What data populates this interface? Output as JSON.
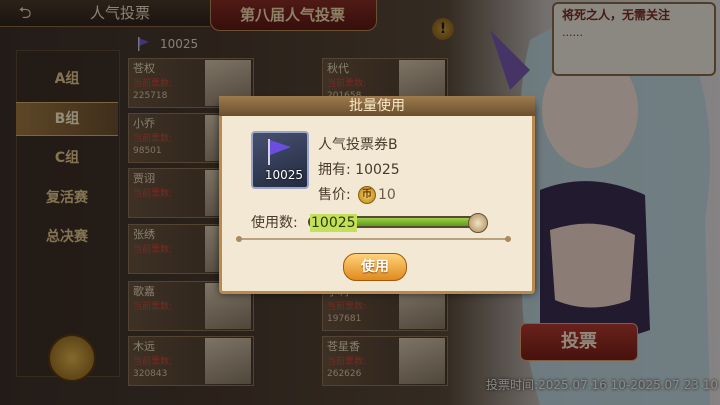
{
  "header": {
    "back_icon": "back-arrow-icon",
    "screen_title": "人气投票",
    "event_title": "第八届人气投票",
    "ticket_count": "10025",
    "info_icon": "exclamation-icon"
  },
  "groups": [
    {
      "label": "A组",
      "selected": false
    },
    {
      "label": "B组",
      "selected": true
    },
    {
      "label": "C组",
      "selected": false
    },
    {
      "label": "复活赛",
      "selected": false
    },
    {
      "label": "总决赛",
      "selected": false
    }
  ],
  "candidates": [
    {
      "name": "苍权",
      "label": "当前票数:",
      "votes": "225718"
    },
    {
      "name": "秋代",
      "label": "当前票数:",
      "votes": "201658"
    },
    {
      "name": "小乔",
      "label": "当前票数:",
      "votes": "98501"
    },
    {
      "name": "",
      "label": "",
      "votes": ""
    },
    {
      "name": "贾诩",
      "label": "当前票数:",
      "votes": ""
    },
    {
      "name": "",
      "label": "",
      "votes": ""
    },
    {
      "name": "张绣",
      "label": "当前票数:",
      "votes": ""
    },
    {
      "name": "",
      "label": "",
      "votes": ""
    },
    {
      "name": "歌嘉",
      "label": "当前票数:",
      "votes": ""
    },
    {
      "name": "小利",
      "label": "当前票数:",
      "votes": "197681"
    },
    {
      "name": "木远",
      "label": "当前票数:",
      "votes": "320843"
    },
    {
      "name": "苍星香",
      "label": "当前票数:",
      "votes": "262626"
    }
  ],
  "speech": {
    "text": "将死之人，无需关注",
    "dots": "......"
  },
  "vote_button": "投票",
  "vote_period": "投票时间:2025.07.16 10-2025.07.23 10",
  "modal": {
    "title": "批量使用",
    "item_name": "人气投票券B",
    "item_qty": "10025",
    "owned_label": "拥有: 10025",
    "price_label": "售价:",
    "price_icon": "coin-icon",
    "price_value": "10",
    "use_count_label": "使用数:",
    "use_count_value": "10025",
    "slider_fraction": 1.0,
    "use_button": "使用"
  },
  "colors": {
    "accent": "#e08a1e",
    "vote_red": "#b53a2e",
    "slider_green": "#9ed046"
  }
}
